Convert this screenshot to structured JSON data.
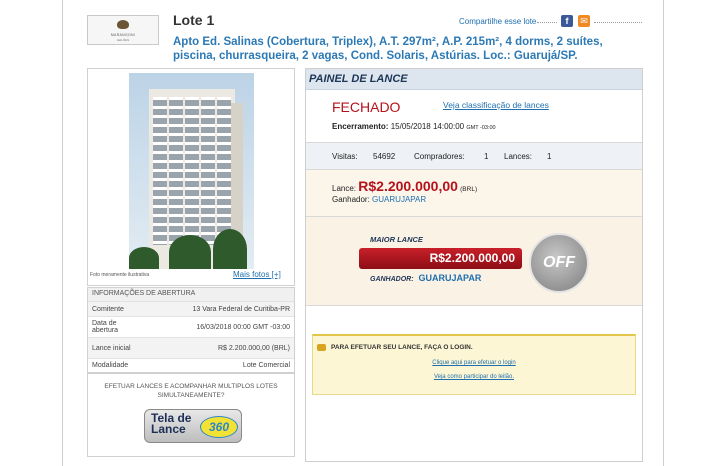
{
  "header": {
    "logo": {
      "name": "MARANGONI",
      "sub": "LEILÕES"
    },
    "lote_title": "Lote 1",
    "share_label": "Compartilhe esse lote",
    "description": "Apto Ed. Salinas (Cobertura, Triplex), A.T. 297m², A.P. 215m², 4 dorms, 2 suítes, piscina, churrasqueira, 2 vagas, Cond. Solaris, Astúrias. Loc.: Guarujá/SP."
  },
  "photo": {
    "caption": "Foto meramente ilustrativa",
    "more_link": "Mais fotos [+]"
  },
  "info": {
    "heading": "INFORMAÇÕES DE ABERTURA",
    "rows": [
      {
        "label": "Comitente",
        "value": "13 Vara Federal de Curitiba-PR"
      },
      {
        "label": "Data de abertura",
        "value": "16/03/2018 00:00 GMT -03:00"
      },
      {
        "label": "Lance inicial",
        "value": "R$ 2.200.000,00 (BRL)"
      },
      {
        "label": "Modalidade",
        "value": "Lote Comercial"
      }
    ]
  },
  "multi": {
    "text": "EFETUAR LANCES E ACOMPANHAR MULTIPLOS LOTES SIMULTANEAMENTE?",
    "button_line1": "Tela de",
    "button_line2": "Lance",
    "button_badge": "360"
  },
  "painel": {
    "title": "PAINEL DE LANCE",
    "status": "FECHADO",
    "classification_link": "Veja classificação de lances",
    "encerramento_label": "Encerramento:",
    "encerramento_value": "15/05/2018 14:00:00",
    "encerramento_tz": "GMT -03:00",
    "visitas_label": "Visitas:",
    "visitas_value": "54692",
    "compradores_label": "Compradores:",
    "compradores_value": "1",
    "lances_label": "Lances:",
    "lances_value": "1",
    "lance_label": "Lance:",
    "lance_value": "R$2.200.000,00",
    "lance_currency": "(BRL)",
    "ganhador_label": "Ganhador:",
    "ganhador_value": "GUARUJAPAR",
    "maior_lance_label": "MAIOR LANCE",
    "maior_lance_value": "R$2.200.000,00",
    "ganhador2_label": "GANHADOR:",
    "ganhador2_value": "GUARUJAPAR",
    "off_label": "OFF",
    "login_message": "PARA EFETUAR SEU LANCE, FAÇA O LOGIN.",
    "login_link": "Clique aqui para efetuar o login",
    "how_link": "Veja como participar do leilão."
  },
  "colors": {
    "accent_blue": "#2c79b5",
    "status_red": "#b5121b",
    "panel_head": "#dde6ef"
  }
}
